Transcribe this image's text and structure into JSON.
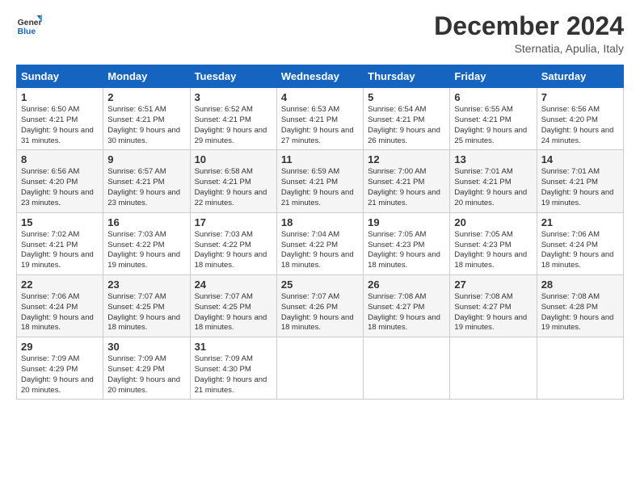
{
  "logo": {
    "line1": "General",
    "line2": "Blue"
  },
  "title": "December 2024",
  "location": "Sternatia, Apulia, Italy",
  "days_header": [
    "Sunday",
    "Monday",
    "Tuesday",
    "Wednesday",
    "Thursday",
    "Friday",
    "Saturday"
  ],
  "weeks": [
    [
      {
        "day": "1",
        "sunrise": "6:50 AM",
        "sunset": "4:21 PM",
        "daylight": "9 hours and 31 minutes."
      },
      {
        "day": "2",
        "sunrise": "6:51 AM",
        "sunset": "4:21 PM",
        "daylight": "9 hours and 30 minutes."
      },
      {
        "day": "3",
        "sunrise": "6:52 AM",
        "sunset": "4:21 PM",
        "daylight": "9 hours and 29 minutes."
      },
      {
        "day": "4",
        "sunrise": "6:53 AM",
        "sunset": "4:21 PM",
        "daylight": "9 hours and 27 minutes."
      },
      {
        "day": "5",
        "sunrise": "6:54 AM",
        "sunset": "4:21 PM",
        "daylight": "9 hours and 26 minutes."
      },
      {
        "day": "6",
        "sunrise": "6:55 AM",
        "sunset": "4:21 PM",
        "daylight": "9 hours and 25 minutes."
      },
      {
        "day": "7",
        "sunrise": "6:56 AM",
        "sunset": "4:20 PM",
        "daylight": "9 hours and 24 minutes."
      }
    ],
    [
      {
        "day": "8",
        "sunrise": "6:56 AM",
        "sunset": "4:20 PM",
        "daylight": "9 hours and 23 minutes."
      },
      {
        "day": "9",
        "sunrise": "6:57 AM",
        "sunset": "4:21 PM",
        "daylight": "9 hours and 23 minutes."
      },
      {
        "day": "10",
        "sunrise": "6:58 AM",
        "sunset": "4:21 PM",
        "daylight": "9 hours and 22 minutes."
      },
      {
        "day": "11",
        "sunrise": "6:59 AM",
        "sunset": "4:21 PM",
        "daylight": "9 hours and 21 minutes."
      },
      {
        "day": "12",
        "sunrise": "7:00 AM",
        "sunset": "4:21 PM",
        "daylight": "9 hours and 21 minutes."
      },
      {
        "day": "13",
        "sunrise": "7:01 AM",
        "sunset": "4:21 PM",
        "daylight": "9 hours and 20 minutes."
      },
      {
        "day": "14",
        "sunrise": "7:01 AM",
        "sunset": "4:21 PM",
        "daylight": "9 hours and 19 minutes."
      }
    ],
    [
      {
        "day": "15",
        "sunrise": "7:02 AM",
        "sunset": "4:21 PM",
        "daylight": "9 hours and 19 minutes."
      },
      {
        "day": "16",
        "sunrise": "7:03 AM",
        "sunset": "4:22 PM",
        "daylight": "9 hours and 19 minutes."
      },
      {
        "day": "17",
        "sunrise": "7:03 AM",
        "sunset": "4:22 PM",
        "daylight": "9 hours and 18 minutes."
      },
      {
        "day": "18",
        "sunrise": "7:04 AM",
        "sunset": "4:22 PM",
        "daylight": "9 hours and 18 minutes."
      },
      {
        "day": "19",
        "sunrise": "7:05 AM",
        "sunset": "4:23 PM",
        "daylight": "9 hours and 18 minutes."
      },
      {
        "day": "20",
        "sunrise": "7:05 AM",
        "sunset": "4:23 PM",
        "daylight": "9 hours and 18 minutes."
      },
      {
        "day": "21",
        "sunrise": "7:06 AM",
        "sunset": "4:24 PM",
        "daylight": "9 hours and 18 minutes."
      }
    ],
    [
      {
        "day": "22",
        "sunrise": "7:06 AM",
        "sunset": "4:24 PM",
        "daylight": "9 hours and 18 minutes."
      },
      {
        "day": "23",
        "sunrise": "7:07 AM",
        "sunset": "4:25 PM",
        "daylight": "9 hours and 18 minutes."
      },
      {
        "day": "24",
        "sunrise": "7:07 AM",
        "sunset": "4:25 PM",
        "daylight": "9 hours and 18 minutes."
      },
      {
        "day": "25",
        "sunrise": "7:07 AM",
        "sunset": "4:26 PM",
        "daylight": "9 hours and 18 minutes."
      },
      {
        "day": "26",
        "sunrise": "7:08 AM",
        "sunset": "4:27 PM",
        "daylight": "9 hours and 18 minutes."
      },
      {
        "day": "27",
        "sunrise": "7:08 AM",
        "sunset": "4:27 PM",
        "daylight": "9 hours and 19 minutes."
      },
      {
        "day": "28",
        "sunrise": "7:08 AM",
        "sunset": "4:28 PM",
        "daylight": "9 hours and 19 minutes."
      }
    ],
    [
      {
        "day": "29",
        "sunrise": "7:09 AM",
        "sunset": "4:29 PM",
        "daylight": "9 hours and 20 minutes."
      },
      {
        "day": "30",
        "sunrise": "7:09 AM",
        "sunset": "4:29 PM",
        "daylight": "9 hours and 20 minutes."
      },
      {
        "day": "31",
        "sunrise": "7:09 AM",
        "sunset": "4:30 PM",
        "daylight": "9 hours and 21 minutes."
      },
      null,
      null,
      null,
      null
    ]
  ]
}
